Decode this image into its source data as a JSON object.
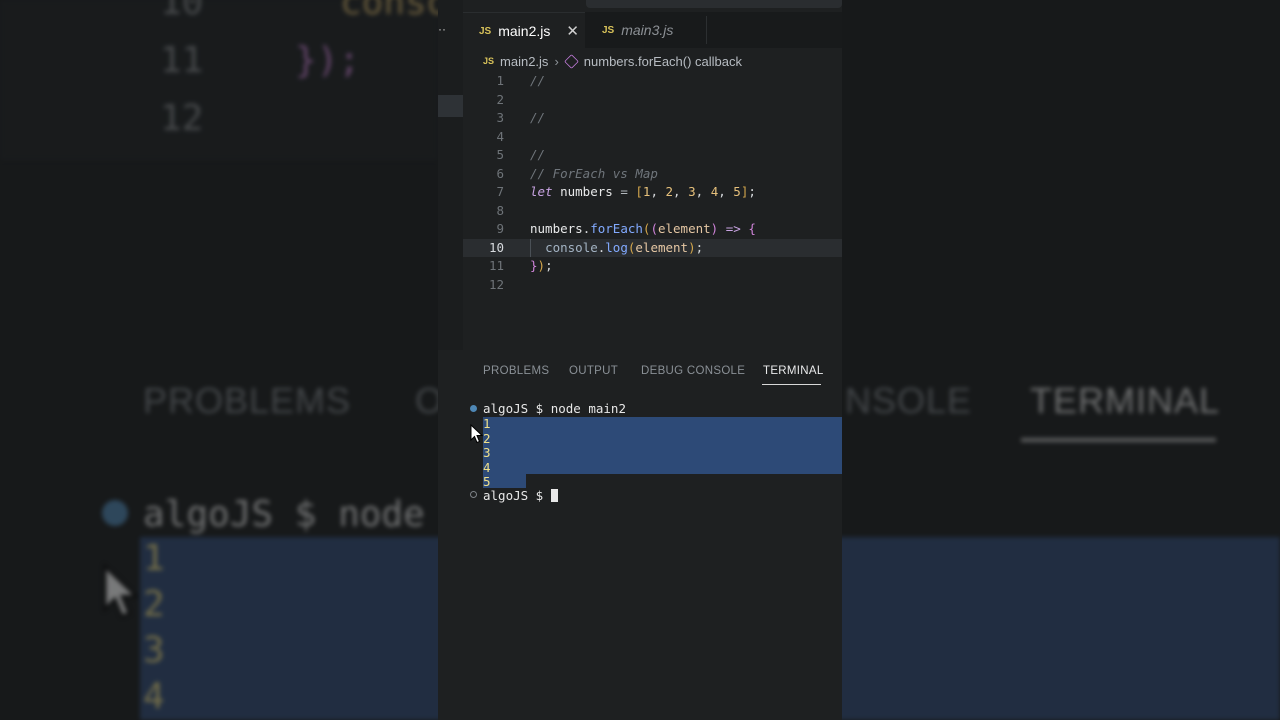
{
  "editor": {
    "tabs": [
      {
        "label": "main2.js",
        "badge": "JS",
        "active": true
      },
      {
        "label": "main3.js",
        "badge": "JS",
        "active": false
      }
    ],
    "tab_close_glyph": "✕",
    "overflow_glyph": "··",
    "breadcrumb": {
      "badge": "JS",
      "file": "main2.js",
      "separator": "›",
      "symbol": "numbers.forEach() callback"
    },
    "lines": [
      {
        "n": "1",
        "text": "//"
      },
      {
        "n": "2",
        "text": ""
      },
      {
        "n": "3",
        "text": "//"
      },
      {
        "n": "4",
        "text": ""
      },
      {
        "n": "5",
        "text": "//"
      },
      {
        "n": "6",
        "text": "// ForEach vs Map"
      },
      {
        "n": "7",
        "text": "let numbers = [1, 2, 3, 4, 5];"
      },
      {
        "n": "8",
        "text": ""
      },
      {
        "n": "9",
        "text": "numbers.forEach((element) => {"
      },
      {
        "n": "10",
        "text": "  console.log(element);"
      },
      {
        "n": "11",
        "text": "});"
      },
      {
        "n": "12",
        "text": ""
      }
    ],
    "current_line": "10"
  },
  "panel": {
    "tabs": [
      "PROBLEMS",
      "OUTPUT",
      "DEBUG CONSOLE",
      "TERMINAL"
    ],
    "active_tab": "TERMINAL"
  },
  "terminal": {
    "command_line": "algoJS $ node main2",
    "output": [
      "1",
      "2",
      "3",
      "4",
      "5"
    ],
    "prompt": "algoJS $ "
  },
  "background": {
    "line_numbers": [
      "10",
      "11",
      "12"
    ],
    "code_fragment": "conso",
    "closing": "});",
    "tabs": [
      "PROBLEMS",
      "O",
      "NSOLE",
      "TERMINAL"
    ],
    "term_command": "algoJS $ node",
    "term_output": [
      "1",
      "2",
      "3",
      "4"
    ]
  },
  "colors": {
    "panel_bg": "#1e2021",
    "selection": "#2d4a77",
    "accent_blue": "#4e87b5"
  }
}
